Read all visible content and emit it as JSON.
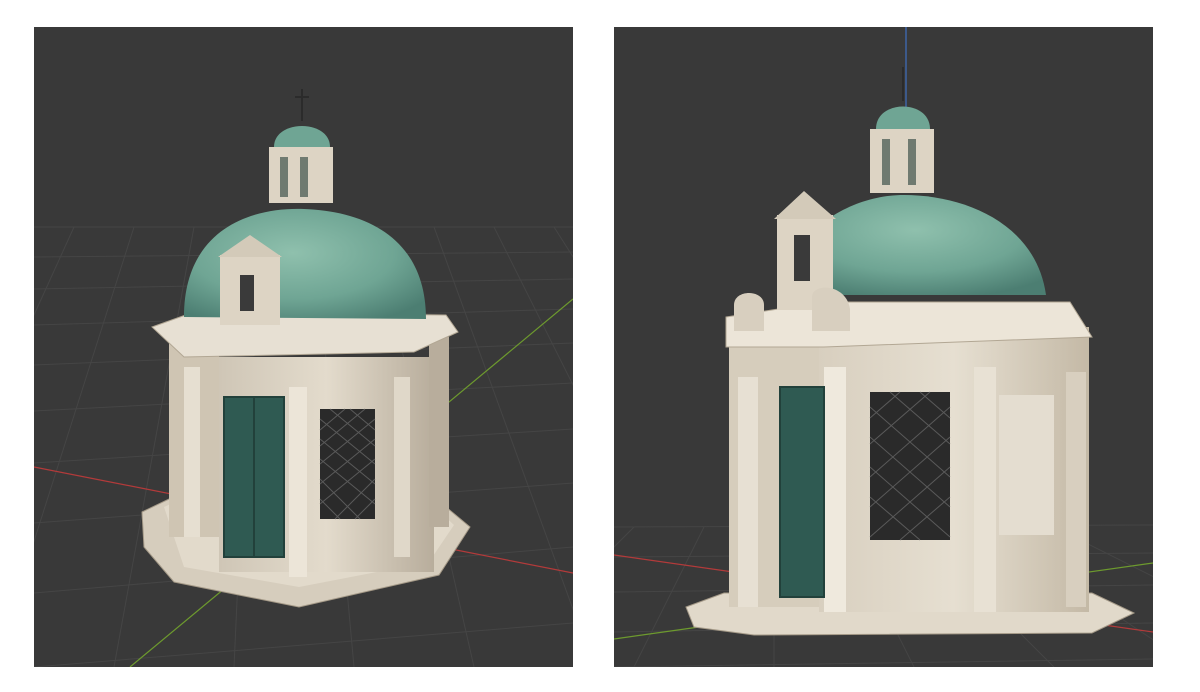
{
  "viewports": [
    {
      "name": "left-viewport",
      "view": "three-quarter"
    },
    {
      "name": "right-viewport",
      "view": "front-left"
    }
  ],
  "colors": {
    "viewport_bg": "#393939",
    "grid_line": "#454545",
    "axis_x": "#b33a3a",
    "axis_y": "#6d9a2e",
    "axis_z": "#3f6fc1",
    "stone": "#d8cfc0",
    "stone_shade": "#b8ad9c",
    "copper_dome": "#6fa594",
    "copper_dark": "#4c7e72",
    "door_bronze": "#2f5a52",
    "window_grate": "#2a2a2a"
  },
  "model": {
    "subject": "chapel-3d-scan",
    "parts": [
      "dome",
      "lantern",
      "bell-gable",
      "pilasters",
      "door",
      "grated-window",
      "octagonal-base"
    ]
  }
}
